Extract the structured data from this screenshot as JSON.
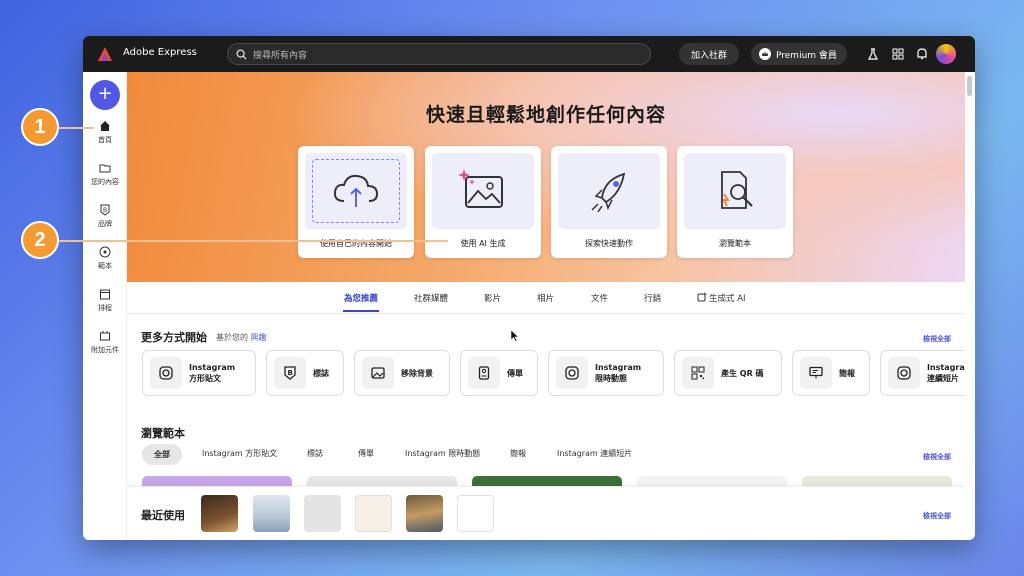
{
  "topbar": {
    "app_name": "Adobe Express",
    "search_placeholder": "搜尋所有內容",
    "join_label": "加入社群",
    "premium_label": "Premium 會員"
  },
  "sidebar": {
    "create_label": "+",
    "items": [
      {
        "label": "首頁",
        "icon": "home-icon"
      },
      {
        "label": "您的內容",
        "icon": "folder-icon"
      },
      {
        "label": "品牌",
        "icon": "brand-icon"
      },
      {
        "label": "範本",
        "icon": "templates-icon"
      },
      {
        "label": "排程",
        "icon": "calendar-icon"
      },
      {
        "label": "附加元件",
        "icon": "addons-icon"
      }
    ]
  },
  "hero": {
    "title": "快速且輕鬆地創作任何內容",
    "cards": [
      {
        "label": "使用自己的內容開始",
        "icon": "upload-cloud-icon"
      },
      {
        "label": "使用 AI 生成",
        "icon": "ai-image-icon"
      },
      {
        "label": "探索快速動作",
        "icon": "rocket-icon"
      },
      {
        "label": "瀏覽範本",
        "icon": "search-document-icon"
      }
    ]
  },
  "tabs": [
    "為您推薦",
    "社群媒體",
    "影片",
    "相片",
    "文件",
    "行銷",
    "生成式 AI"
  ],
  "more_ways": {
    "title": "更多方式開始",
    "subtitle_prefix": "基於您的",
    "subtitle_link": "興趣",
    "view_all": "檢視全部",
    "items": [
      {
        "label": "Instagram\n方形貼文",
        "icon": "instagram-icon"
      },
      {
        "label": "標誌",
        "icon": "logo-icon"
      },
      {
        "label": "移除背景",
        "icon": "image-icon"
      },
      {
        "label": "傳單",
        "icon": "flyer-icon"
      },
      {
        "label": "Instagram\n限時動態",
        "icon": "instagram-icon"
      },
      {
        "label": "產生 QR 碼",
        "icon": "qr-code-icon"
      },
      {
        "label": "簡報",
        "icon": "presentation-icon"
      },
      {
        "label": "Instagram\n連續短片",
        "icon": "instagram-icon"
      }
    ]
  },
  "browse": {
    "title": "瀏覽範本",
    "view_all": "檢視全部",
    "chips": [
      "全部",
      "Instagram 方形貼文",
      "標誌",
      "傳單",
      "Instagram 限時動態",
      "簡報",
      "Instagram 連續短片"
    ]
  },
  "recent": {
    "title": "最近使用",
    "view_all": "檢視全部"
  },
  "annotations": [
    "1",
    "2"
  ],
  "colors": {
    "accent": "#5258e4",
    "callout": "#f39a32",
    "link": "#4c57d6"
  }
}
